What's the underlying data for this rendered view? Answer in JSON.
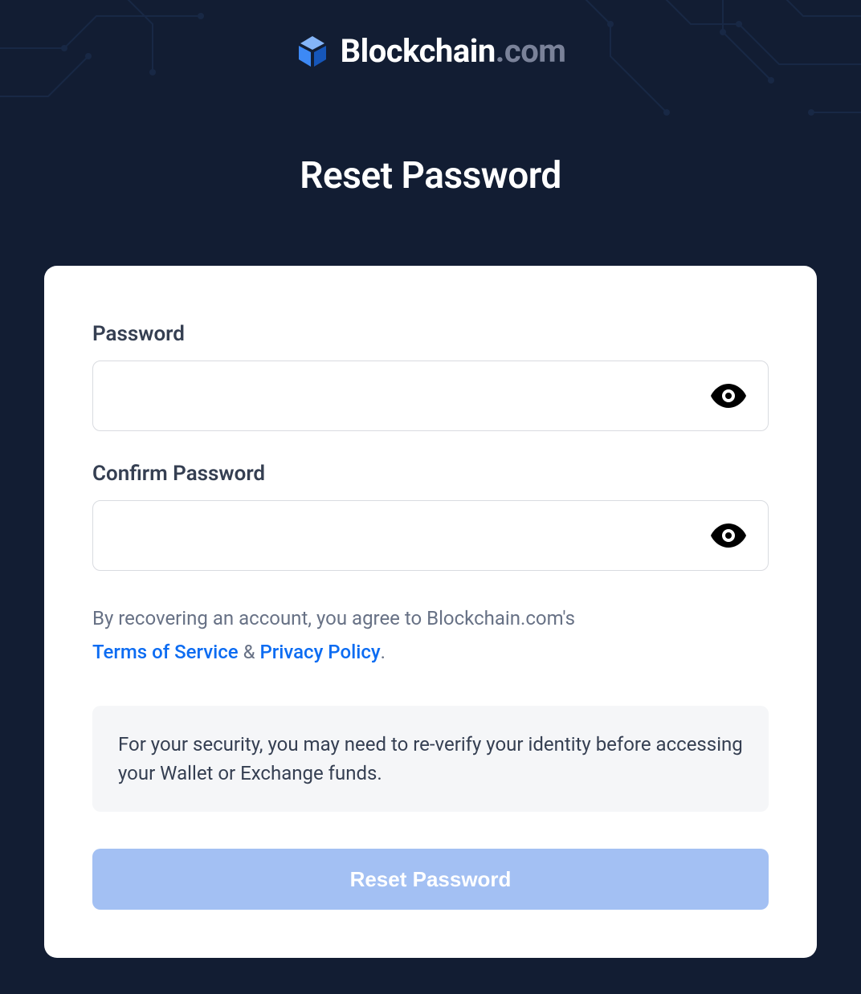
{
  "brand": {
    "main": "Blockchain",
    "domain": ".com"
  },
  "page_title": "Reset Password",
  "form": {
    "password_label": "Password",
    "confirm_label": "Confirm Password",
    "password_value": "",
    "confirm_value": ""
  },
  "legal": {
    "prefix": "By recovering an account, you agree to Blockchain.com's",
    "tos": "Terms of Service",
    "amp": " & ",
    "privacy": "Privacy Policy",
    "suffix": "."
  },
  "info_text": "For your security, you may need to re-verify your identity before accessing your Wallet or Exchange funds.",
  "submit_label": "Reset Password"
}
